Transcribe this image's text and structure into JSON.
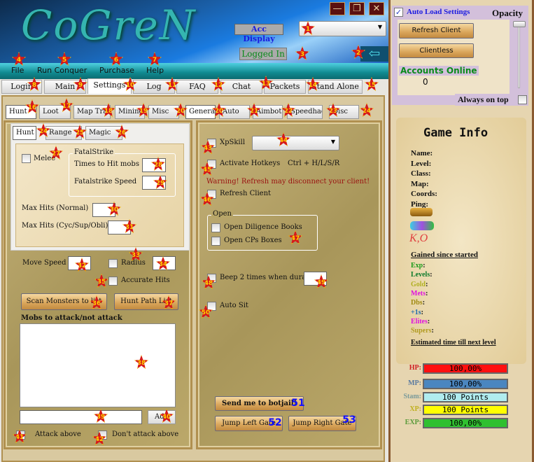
{
  "header": {
    "logo": "CoGreN",
    "minimize": "—",
    "restore": "❐",
    "close": "✕",
    "acc_display": "Acc Display",
    "acc_select": "",
    "status": "Logged In",
    "back_icon": "arrow-left-icon"
  },
  "menu": [
    "File",
    "Run Conquer",
    "Purchase",
    "Help"
  ],
  "tabs": [
    "Login",
    "Main",
    "Settings",
    "Log",
    "FAQ",
    "Chat",
    "Packets",
    "Stand Alone"
  ],
  "subtabs_left": [
    "Hunt",
    "Loot",
    "Map Travel",
    "Mining",
    "Misc"
  ],
  "subtabs_right": [
    "General",
    "Auto",
    "Aimbot",
    "Speedhacks",
    "Disc"
  ],
  "hunt_tabs": [
    "Hunt",
    "Range",
    "Magic"
  ],
  "hunt": {
    "melee": "Melee",
    "fatal_group": "FatalStrike",
    "times_to_hit": "Times to Hit mobs",
    "fatal_speed": "Fatalstrike Speed",
    "max_hits_normal": "Max Hits (Normal)",
    "max_hits_cyc": "Max Hits (Cyc/Sup/Obli)",
    "move_speed": "Move Speed",
    "radius": "Radius",
    "accurate_hits": "Accurate Hits",
    "scan_btn": "Scan Monsters to list",
    "path_btn": "Hunt Path List",
    "mobs_label": "Mobs to attack/not attack",
    "add_btn": "Add",
    "attack_above": "Attack above",
    "dont_attack_above": "Don't attack above"
  },
  "general": {
    "xpskill": "XpSkill",
    "xpskill_value": "",
    "hotkeys": "Activate Hotkeys",
    "hotkeys_combo": "Ctrl + H/L/S/R",
    "warning": "Warning! Refresh may disconnect your client!",
    "refresh": "Refresh Client",
    "open_group": "Open",
    "open_books": "Open Diligence Books",
    "open_cps": "Open CPs Boxes",
    "beep": "Beep 2 times when dura:",
    "auto_sit": "Auto Sit",
    "botjail": "Send me to botjail!",
    "jump_left": "Jump Left Gate",
    "jump_right": "Jump Right Gate"
  },
  "side": {
    "auto_load": "Auto Load Settings",
    "auto_load_checked": true,
    "opacity": "Opacity",
    "opacity_value": 100,
    "refresh_client": "Refresh Client",
    "clientless": "Clientless",
    "accounts_online": "Accounts Online",
    "accounts_count": "0",
    "always_on_top": "Always on top",
    "always_on_top_checked": false
  },
  "game_info": {
    "title": "Game Info",
    "fields": [
      "Name:",
      "Level:",
      "Class:",
      "Map:",
      "Coords:",
      "Ping:"
    ],
    "gained_title": "Gained since started",
    "gained": [
      {
        "label": "Exp",
        "color": "#1a9a1a"
      },
      {
        "label": "Levels",
        "color": "#0a7a2a"
      },
      {
        "label": "Gold",
        "color": "#b0b020"
      },
      {
        "label": "Mets",
        "color": "#e010e0"
      },
      {
        "label": "Dbs",
        "color": "#a08a10"
      },
      {
        "label": "+1s",
        "color": "#1a6ab0"
      },
      {
        "label": "Elites",
        "color": "#e010e0"
      },
      {
        "label": "Supers",
        "color": "#b09a20"
      }
    ],
    "estimated": "Estimated time till next level",
    "ko": "K,O"
  },
  "bars": [
    {
      "label": "HP:",
      "text": "100,00%",
      "color": "#ff1010",
      "lcolor": "#d02020",
      "value": 100
    },
    {
      "label": "MP:",
      "text": "100,00%",
      "color": "#4a86c0",
      "lcolor": "#5a7aa0",
      "value": 100
    },
    {
      "label": "Stam:",
      "text": "100 Points",
      "color": "#b0ecef",
      "lcolor": "#7a9a9a",
      "value": 100
    },
    {
      "label": "XP:",
      "text": "100 Points",
      "color": "#ffff00",
      "lcolor": "#c0b020",
      "value": 100
    },
    {
      "label": "EXP:",
      "text": "100,00%",
      "color": "#30c030",
      "lcolor": "#5a9a3a",
      "value": 100
    }
  ],
  "markers": [
    1,
    2,
    3,
    4,
    5,
    6,
    7,
    8,
    9,
    10,
    11,
    12,
    13,
    14,
    15,
    16,
    17,
    18,
    19,
    20,
    20,
    21,
    22,
    23,
    24,
    24,
    25,
    26,
    27,
    28,
    29,
    30,
    31,
    32,
    33,
    34,
    35,
    36,
    37,
    38,
    39,
    40,
    41,
    42,
    43,
    44,
    45,
    46,
    47,
    48,
    49,
    50,
    51,
    52,
    53
  ]
}
